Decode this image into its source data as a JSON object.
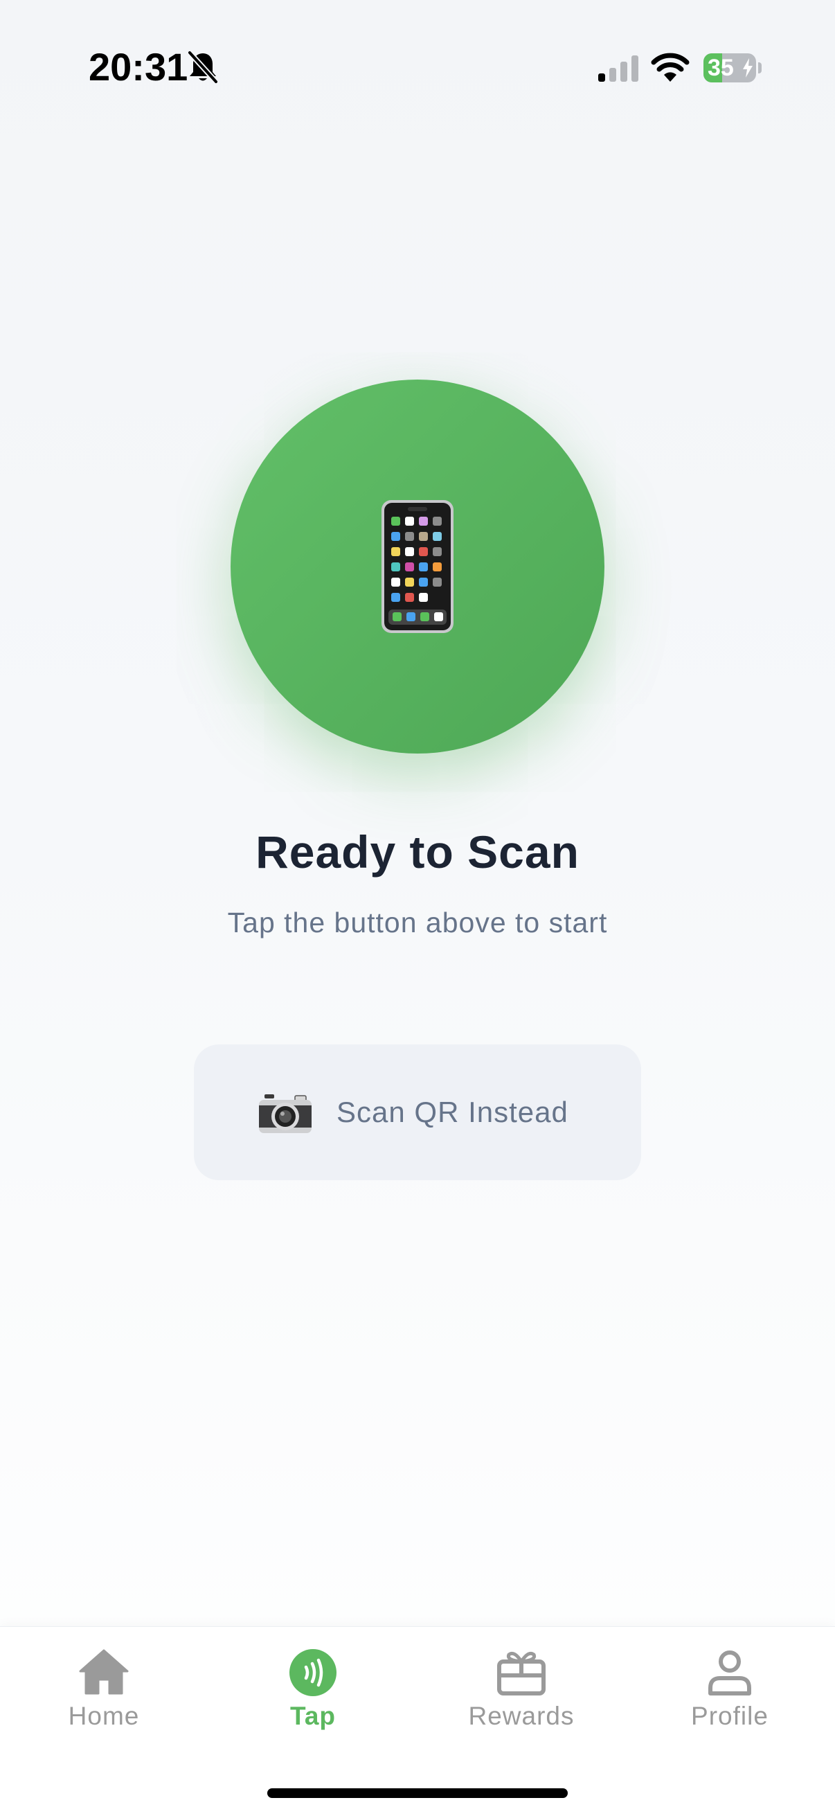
{
  "status_bar": {
    "time": "20:31",
    "battery_level": "35",
    "battery_fraction": 0.35,
    "icons": [
      "bell-slash-icon",
      "cellular-signal-icon",
      "wifi-icon",
      "battery-charging-icon"
    ]
  },
  "main": {
    "tap_button_icon": "mobile-phone-icon",
    "title": "Ready to Scan",
    "subtitle": "Tap the button above to start",
    "scan_qr_button": {
      "icon": "camera-icon",
      "label": "Scan QR Instead"
    }
  },
  "tab_bar": {
    "tabs": [
      {
        "label": "Home",
        "icon": "house-icon",
        "active": false
      },
      {
        "label": "Tap",
        "icon": "contactless-icon",
        "active": true
      },
      {
        "label": "Rewards",
        "icon": "gift-icon",
        "active": false
      },
      {
        "label": "Profile",
        "icon": "person-icon",
        "active": false
      }
    ]
  },
  "colors": {
    "accent_green": "#5cb85f",
    "title_text": "#1c2433",
    "muted_text": "#66748a",
    "inactive_tab": "#9a9a9a"
  }
}
